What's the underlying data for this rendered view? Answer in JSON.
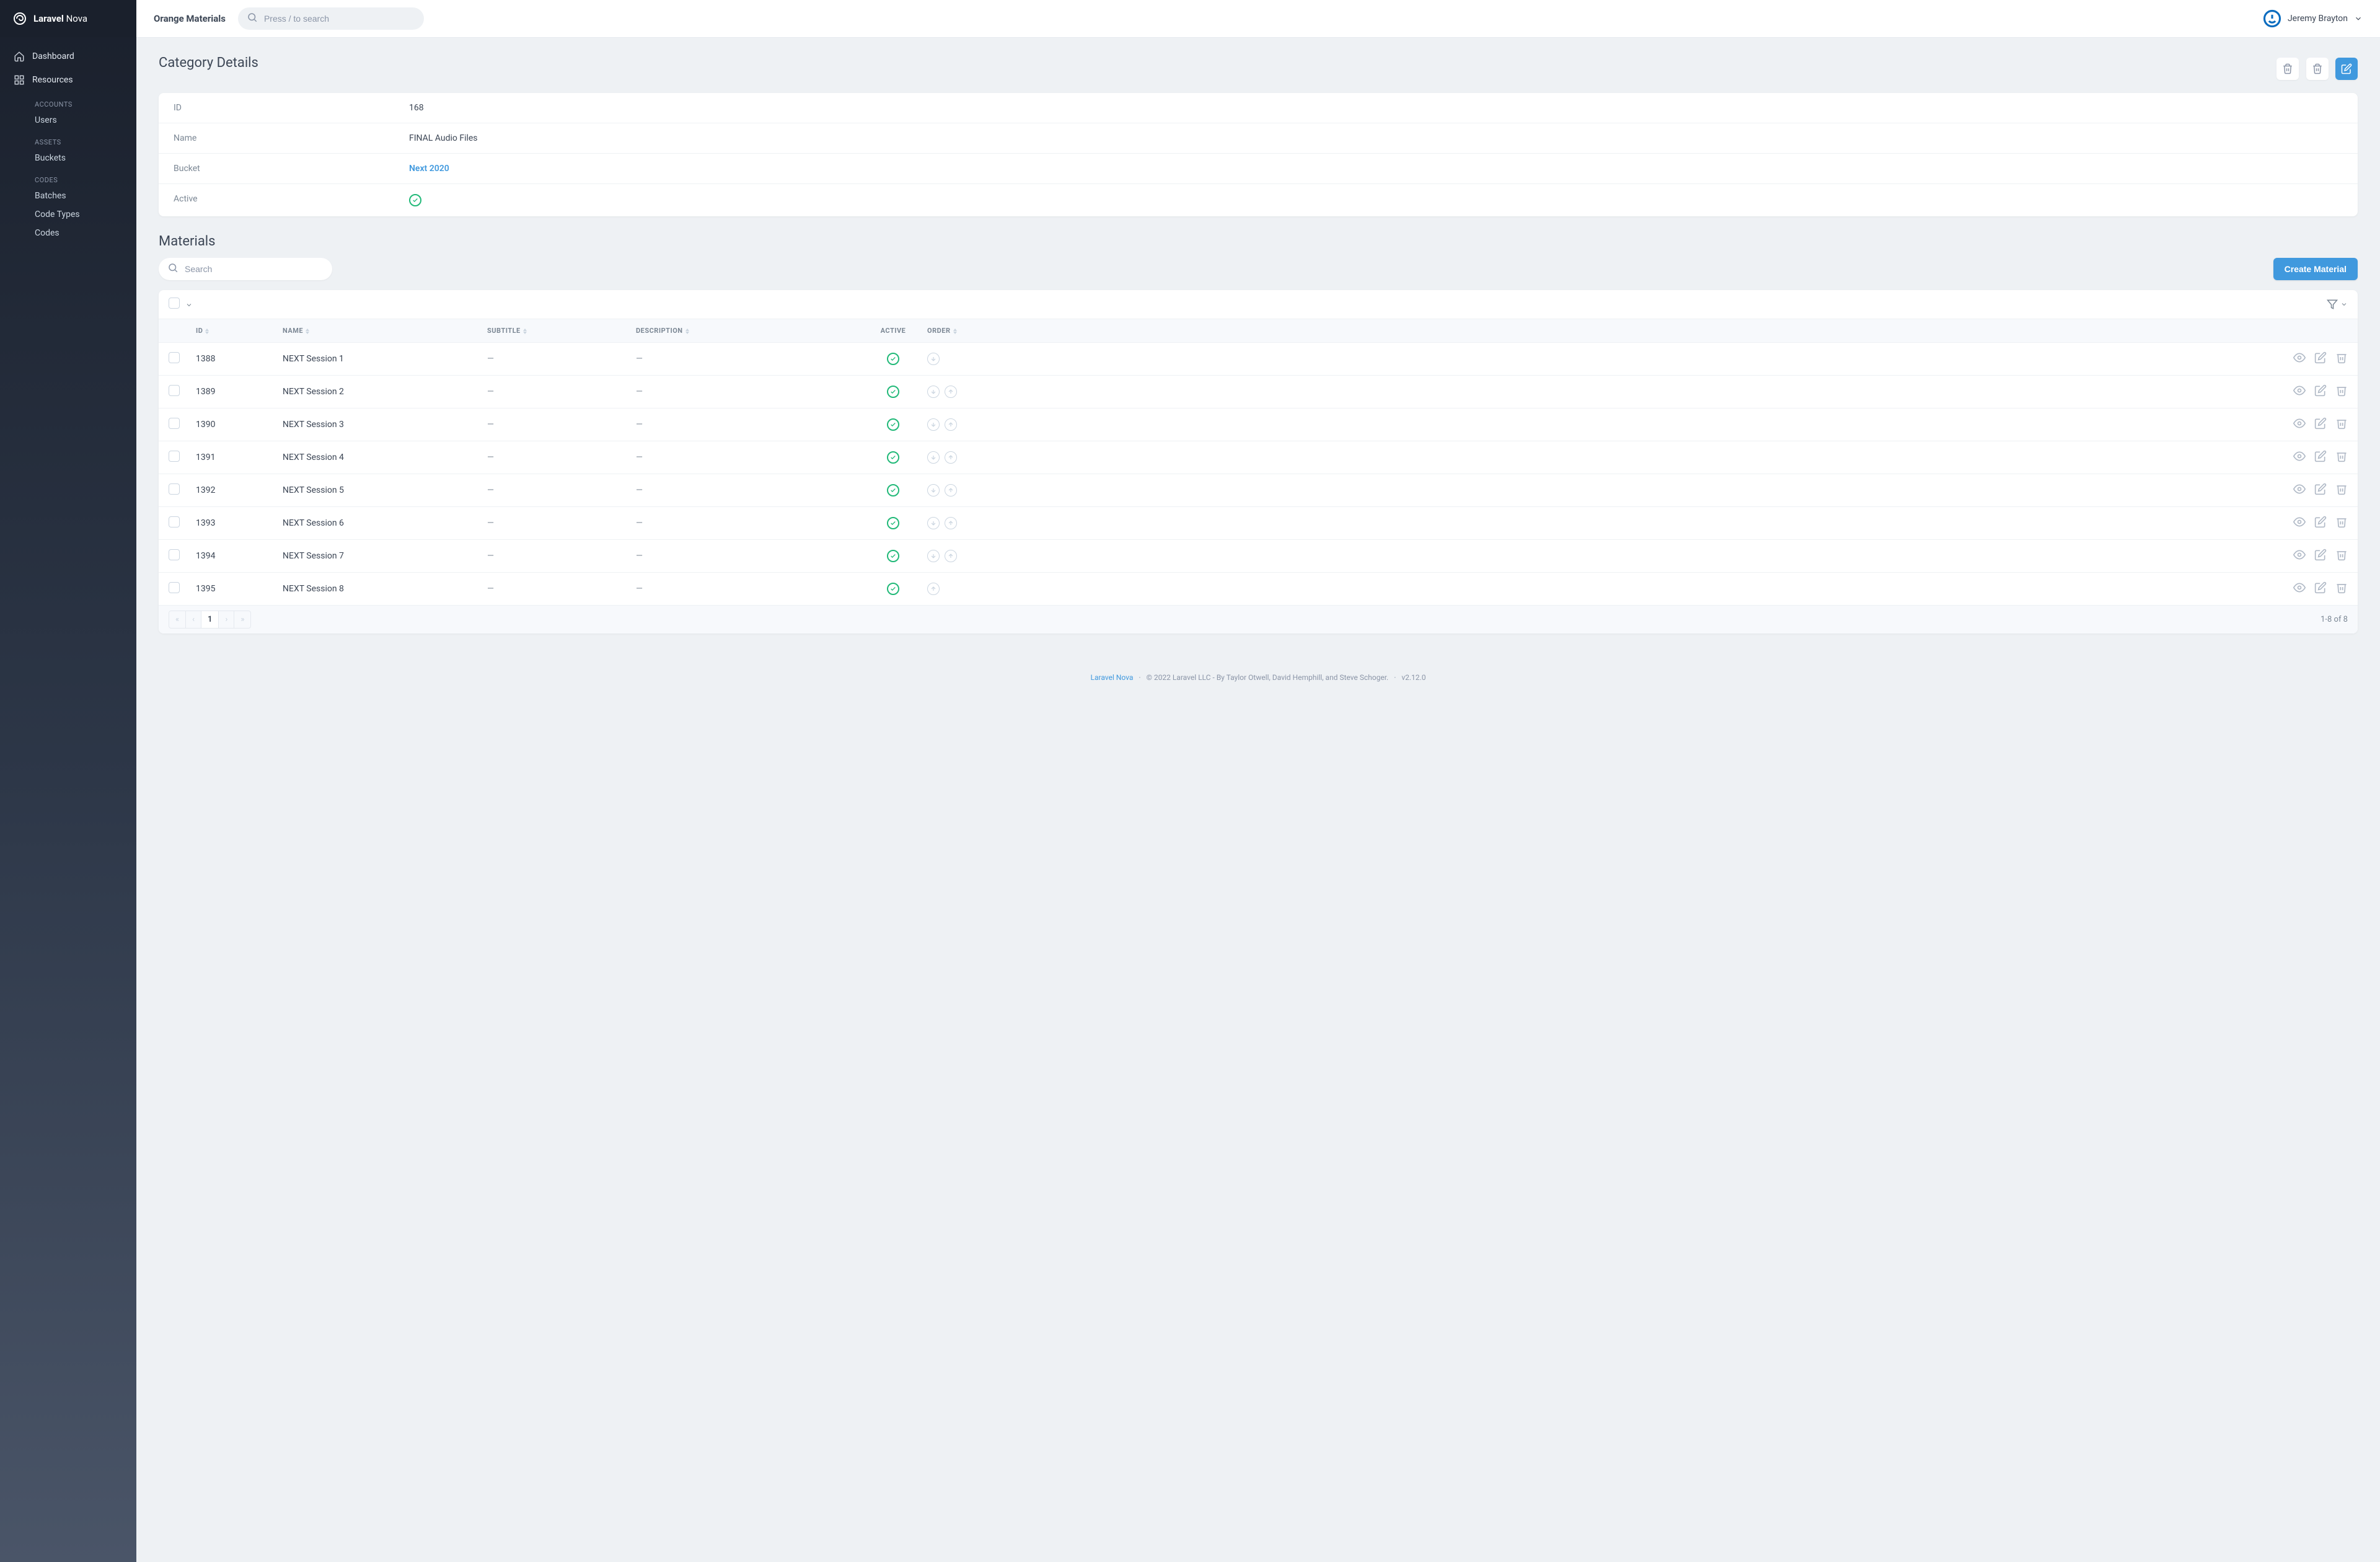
{
  "brand": {
    "name_bold": "Laravel",
    "name_light": " Nova"
  },
  "topbar": {
    "title": "Orange Materials",
    "search_placeholder": "Press / to search",
    "user_name": "Jeremy Brayton"
  },
  "sidebar": {
    "dashboard": "Dashboard",
    "resources": "Resources",
    "groups": [
      {
        "label": "ACCOUNTS",
        "items": [
          "Users"
        ]
      },
      {
        "label": "ASSETS",
        "items": [
          "Buckets"
        ]
      },
      {
        "label": "CODES",
        "items": [
          "Batches",
          "Code Types",
          "Codes"
        ]
      }
    ]
  },
  "details": {
    "heading": "Category Details",
    "rows": {
      "id_label": "ID",
      "id_value": "168",
      "name_label": "Name",
      "name_value": "FINAL Audio Files",
      "bucket_label": "Bucket",
      "bucket_value": "Next 2020",
      "active_label": "Active"
    }
  },
  "materials": {
    "heading": "Materials",
    "search_placeholder": "Search",
    "create_btn": "Create Material",
    "columns": {
      "id": "ID",
      "name": "NAME",
      "subtitle": "SUBTITLE",
      "description": "DESCRIPTION",
      "active": "ACTIVE",
      "order": "ORDER"
    },
    "rows": [
      {
        "id": "1388",
        "name": "NEXT Session 1",
        "subtitle": "—",
        "description": "—",
        "up": false,
        "down": true
      },
      {
        "id": "1389",
        "name": "NEXT Session 2",
        "subtitle": "—",
        "description": "—",
        "up": true,
        "down": true
      },
      {
        "id": "1390",
        "name": "NEXT Session 3",
        "subtitle": "—",
        "description": "—",
        "up": true,
        "down": true
      },
      {
        "id": "1391",
        "name": "NEXT Session 4",
        "subtitle": "—",
        "description": "—",
        "up": true,
        "down": true
      },
      {
        "id": "1392",
        "name": "NEXT Session 5",
        "subtitle": "—",
        "description": "—",
        "up": true,
        "down": true
      },
      {
        "id": "1393",
        "name": "NEXT Session 6",
        "subtitle": "—",
        "description": "—",
        "up": true,
        "down": true
      },
      {
        "id": "1394",
        "name": "NEXT Session 7",
        "subtitle": "—",
        "description": "—",
        "up": true,
        "down": true
      },
      {
        "id": "1395",
        "name": "NEXT Session 8",
        "subtitle": "—",
        "description": "—",
        "up": true,
        "down": false
      }
    ],
    "pagination": {
      "page": "1",
      "info": "1-8 of 8"
    }
  },
  "footer": {
    "link": "Laravel Nova",
    "copyright": "© 2022 Laravel LLC - By Taylor Otwell, David Hemphill, and Steve Schoger.",
    "version": "v2.12.0"
  }
}
